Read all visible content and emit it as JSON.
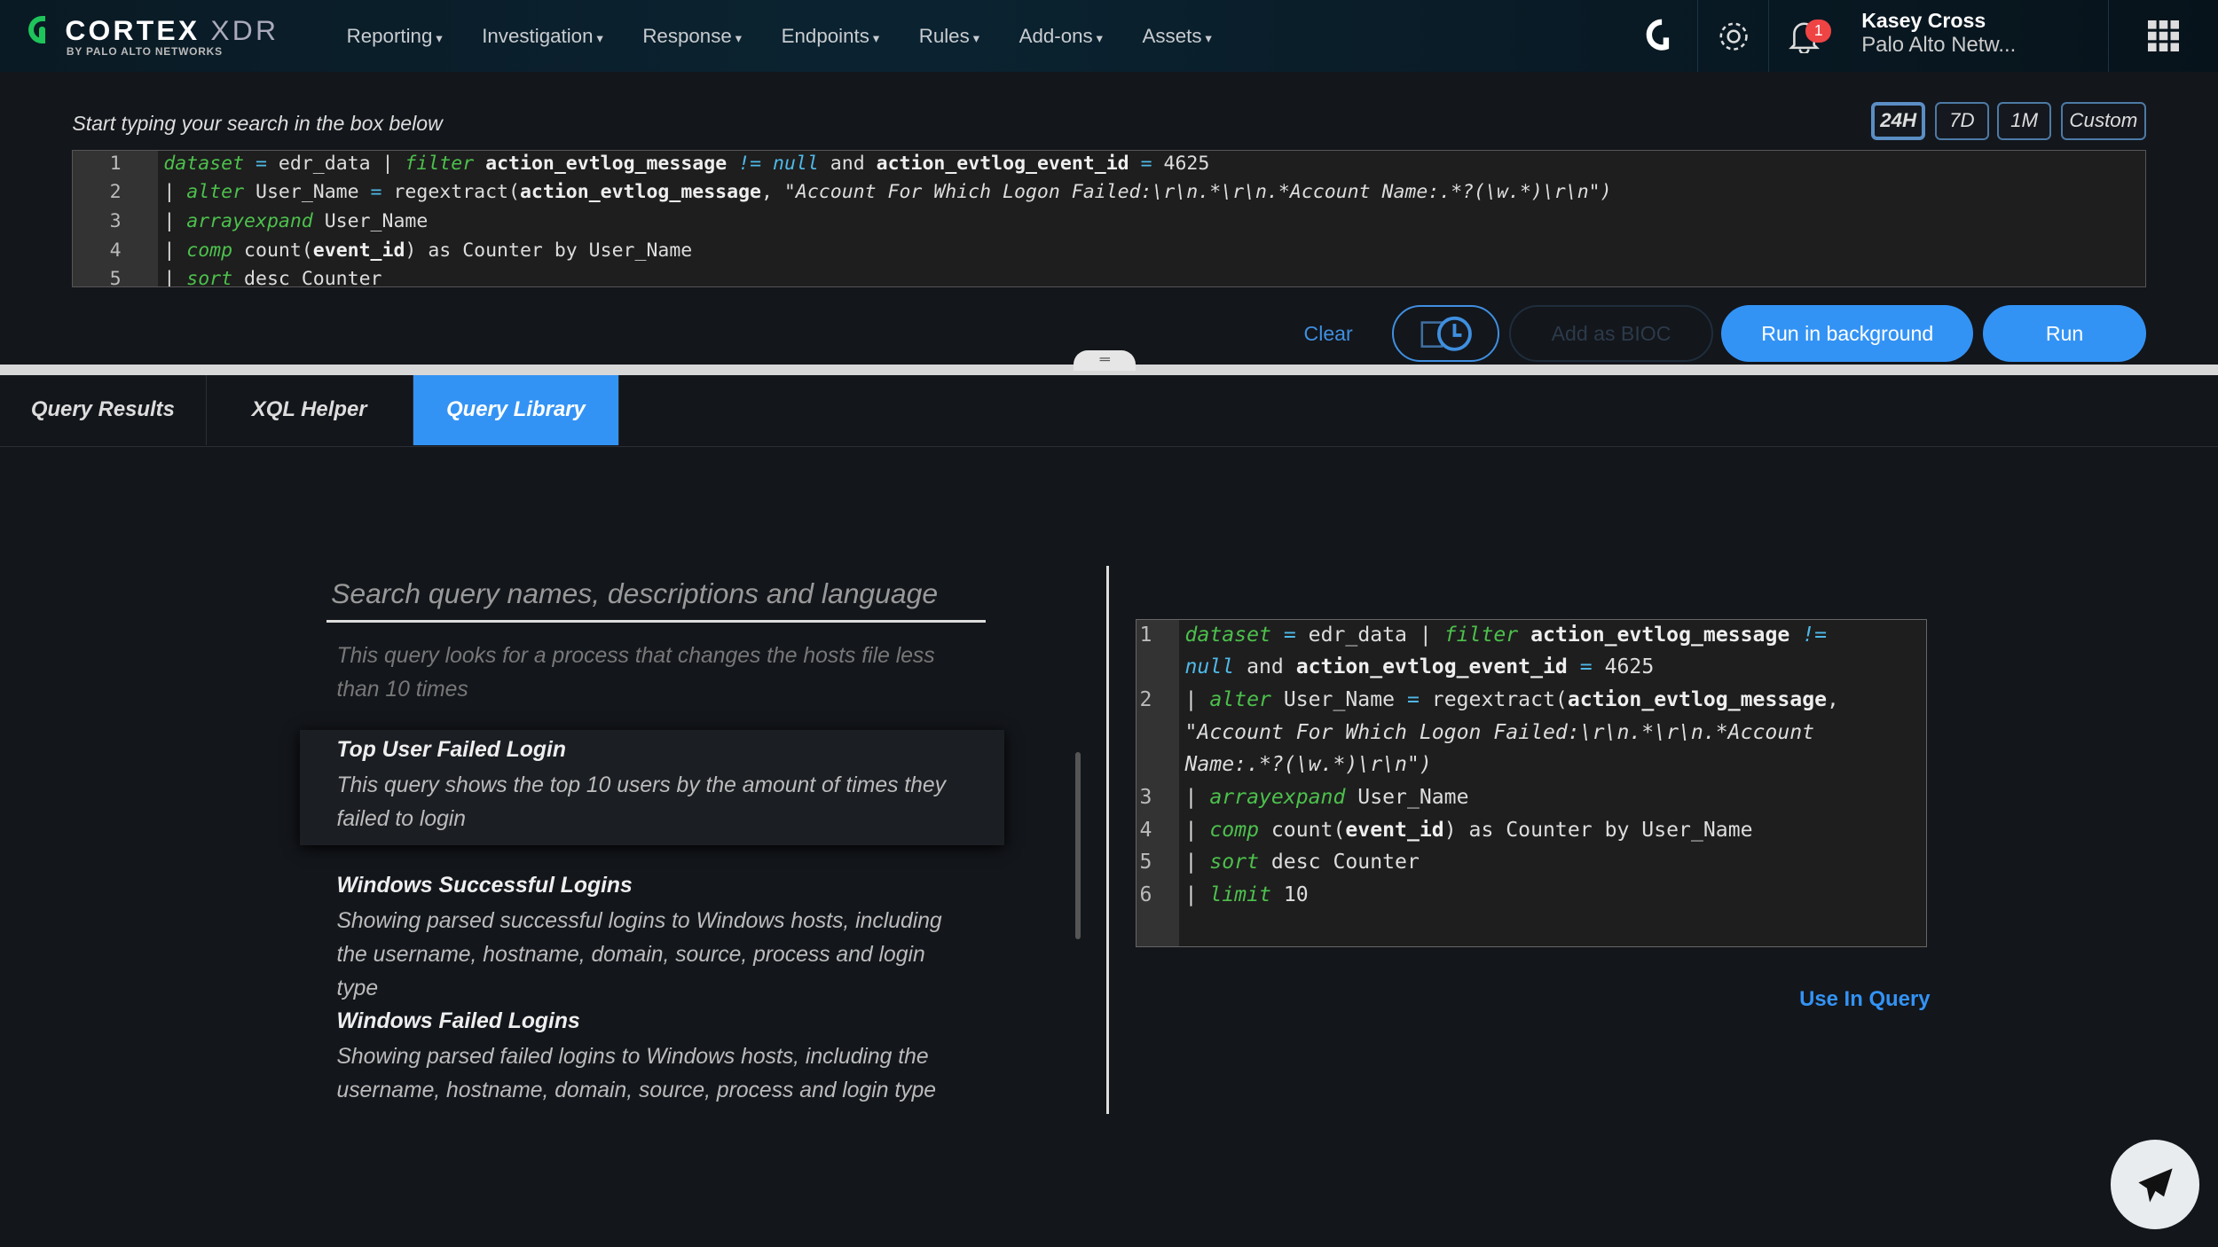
{
  "nav": {
    "brand": "CORTEX",
    "brand_suffix": "XDR",
    "brand_sub": "BY PALO ALTO NETWORKS",
    "menu": [
      "Reporting",
      "Investigation",
      "Response",
      "Endpoints",
      "Rules",
      "Add-ons",
      "Assets"
    ],
    "notification_count": "1",
    "user_name": "Kasey Cross",
    "user_org": "Palo Alto Netw...",
    "icons": [
      "cortex-ring-icon",
      "gear-icon",
      "bell-icon",
      "apps-grid-icon"
    ]
  },
  "query": {
    "hint": "Start typing your search in the box below",
    "time_ranges": [
      "24H",
      "7D",
      "1M",
      "Custom"
    ],
    "selected_range": "24H",
    "lines": [
      [
        [
          "dataset",
          "kw"
        ],
        " ",
        [
          "=",
          "op"
        ],
        " edr_data | ",
        [
          "filter",
          "kw"
        ],
        " ",
        [
          "action_evtlog_message",
          "fd"
        ],
        " ",
        [
          "!=",
          "nl"
        ],
        " ",
        [
          "null",
          "nl"
        ],
        " and ",
        [
          "action_evtlog_event_id",
          "fd"
        ],
        " ",
        [
          "=",
          "op"
        ],
        " 4625"
      ],
      [
        "| ",
        [
          "alter",
          "kw"
        ],
        " User_Name ",
        [
          "=",
          "op"
        ],
        " regextract(",
        [
          "action_evtlog_message",
          "fd"
        ],
        ", ",
        [
          "\"Account For Which Logon Failed:\\r\\n.*\\r\\n.*Account Name:.*?(\\w.*)\\r\\n\")",
          "st"
        ]
      ],
      [
        "| ",
        [
          "arrayexpand",
          "kw"
        ],
        " User_Name"
      ],
      [
        "| ",
        [
          "comp",
          "kw"
        ],
        " count(",
        [
          "event_id",
          "fd"
        ],
        ") as Counter by User_Name"
      ],
      [
        "| ",
        [
          "sort",
          "kw"
        ],
        " desc Counter"
      ]
    ],
    "clear": "Clear",
    "add_bioc": "Add as BIOC",
    "run_bg": "Run in background",
    "run": "Run"
  },
  "tabs": [
    {
      "label": "Query Results"
    },
    {
      "label": "XQL Helper"
    },
    {
      "label": "Query Library",
      "active": true
    }
  ],
  "library": {
    "search_placeholder": "Search query names, descriptions and language",
    "items": [
      {
        "title": "",
        "desc": "This query looks for a process that changes the hosts file less than 10 times"
      },
      {
        "title": "Top User Failed Login",
        "desc": "This query shows the top 10 users by the amount of times they failed to login",
        "selected": true
      },
      {
        "title": "Windows Successful Logins",
        "desc": "Showing parsed successful logins to Windows hosts, including the username, hostname, domain, source, process and login type"
      },
      {
        "title": "Windows Failed Logins",
        "desc": "Showing parsed failed logins to Windows hosts, including the username, hostname, domain, source, process and login type"
      }
    ],
    "preview_lines": [
      {
        "n": "1",
        "rows": [
          [
            [
              "dataset",
              "kw"
            ],
            " ",
            [
              "=",
              "op"
            ],
            " edr_data | ",
            [
              "filter",
              "kw"
            ],
            " ",
            [
              "action_evtlog_message",
              "fd"
            ],
            " ",
            [
              "!=",
              "nl"
            ]
          ],
          [
            [
              "null",
              "nl"
            ],
            " and ",
            [
              "action_evtlog_event_id",
              "fd"
            ],
            " ",
            [
              "=",
              "op"
            ],
            " 4625"
          ]
        ]
      },
      {
        "n": "2",
        "rows": [
          [
            "| ",
            [
              "alter",
              "kw"
            ],
            " User_Name ",
            [
              "=",
              "op"
            ],
            " regextract(",
            [
              "action_evtlog_message",
              "fd"
            ],
            ","
          ],
          [
            [
              "\"Account For Which Logon Failed:\\r\\n.*\\r\\n.*Account",
              "st"
            ]
          ],
          [
            [
              "Name:.*?(\\w.*)\\r\\n\")",
              "st"
            ]
          ]
        ]
      },
      {
        "n": "3",
        "rows": [
          [
            "| ",
            [
              "arrayexpand",
              "kw"
            ],
            " User_Name"
          ]
        ]
      },
      {
        "n": "4",
        "rows": [
          [
            "| ",
            [
              "comp",
              "kw"
            ],
            " count(",
            [
              "event_id",
              "fd"
            ],
            ") as Counter by User_Name"
          ]
        ]
      },
      {
        "n": "5",
        "rows": [
          [
            "| ",
            [
              "sort",
              "kw"
            ],
            " desc Counter"
          ]
        ]
      },
      {
        "n": "6",
        "rows": [
          [
            "| ",
            [
              "limit",
              "kw"
            ],
            " 10"
          ]
        ]
      }
    ],
    "use_in_query": "Use In Query"
  },
  "colors": {
    "accent": "#3393f5",
    "keyword": "#4cc04c",
    "operator": "#4fb9e8",
    "brand_green": "#1ec45a",
    "badge": "#ef4444"
  }
}
